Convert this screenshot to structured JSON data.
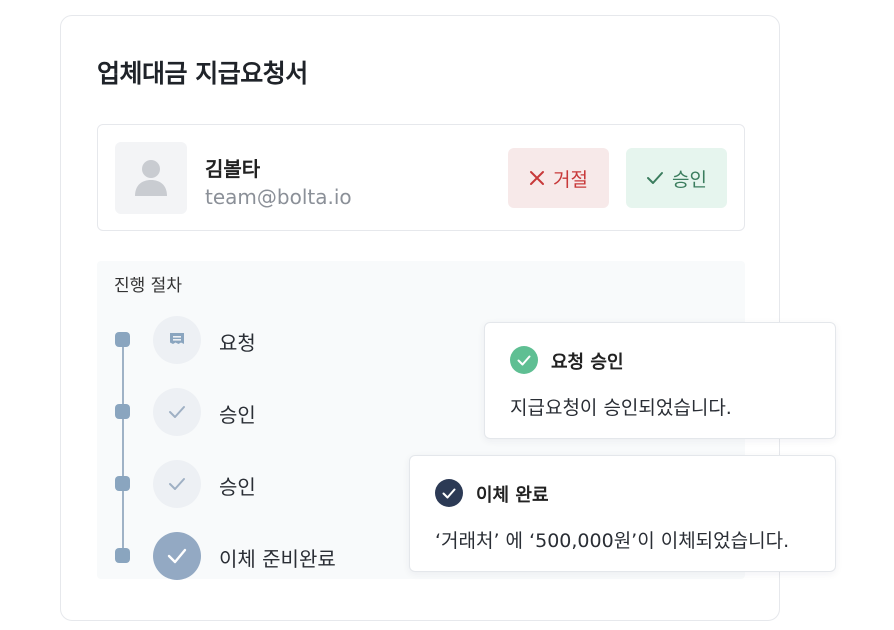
{
  "card": {
    "title": "업체대금 지급요청서"
  },
  "requester": {
    "name": "김볼타",
    "email": "team@bolta.io",
    "avatar_icon": "user-silhouette-icon",
    "reject_label": "거절",
    "approve_label": "승인",
    "reject_icon": "x-icon",
    "approve_icon": "check-icon"
  },
  "process": {
    "title": "진행 절차",
    "steps": [
      {
        "label": "요청",
        "icon": "receipt-icon",
        "state": "pending"
      },
      {
        "label": "승인",
        "icon": "check-icon",
        "state": "pending"
      },
      {
        "label": "승인",
        "icon": "check-icon",
        "state": "pending"
      },
      {
        "label": "이체 준비완료",
        "icon": "check-icon",
        "state": "done"
      }
    ]
  },
  "toasts": [
    {
      "title": "요청 승인",
      "message": "지급요청이 승인되었습니다.",
      "icon": "check-circle-icon",
      "color": "#5fbf93"
    },
    {
      "title": "이체 완료",
      "message": "‘거래처’ 에 ‘500,000원’이 이체되었습니다.",
      "icon": "check-circle-icon",
      "color": "#2c3a55"
    }
  ],
  "colors": {
    "reject_bg": "#f7e9e9",
    "reject_text": "#c8393a",
    "approve_bg": "#e6f5ee",
    "approve_text": "#3b7d5e",
    "timeline": "#8aa5bf"
  }
}
